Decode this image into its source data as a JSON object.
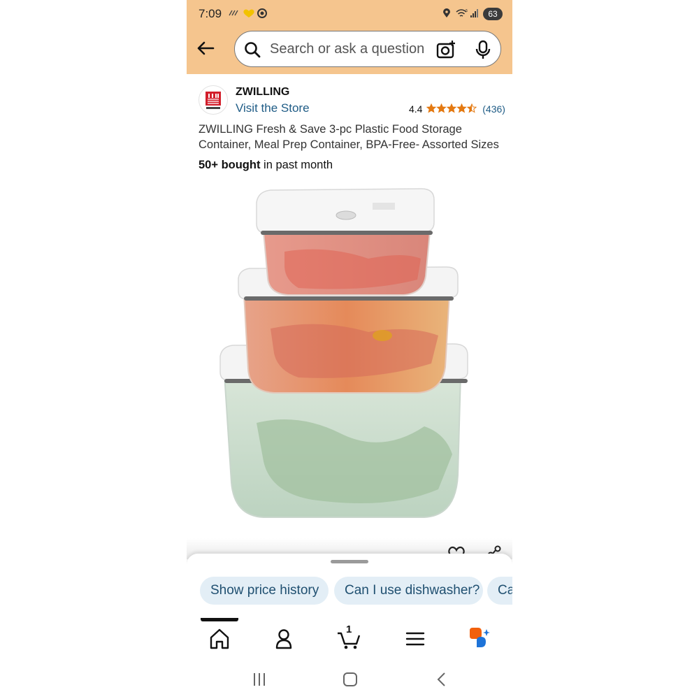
{
  "status_bar": {
    "time": "7:09",
    "battery": "63",
    "icons": [
      "signal-lines-icon",
      "heart-wing-icon",
      "record-icon",
      "location-icon",
      "wifi-icon",
      "cell-signal-icon"
    ]
  },
  "header": {
    "search_placeholder": "Search or ask a question",
    "icons": [
      "back-arrow-icon",
      "search-icon",
      "camera-icon",
      "mic-icon"
    ],
    "background_color": "#F5C58E"
  },
  "product": {
    "brand": "ZWILLING",
    "visit_store": "Visit the Store",
    "rating": "4.4",
    "rating_stars": 4.4,
    "review_count": "(436)",
    "title": "ZWILLING Fresh & Save 3-pc Plastic Food Storage Container, Meal Prep Container, BPA-Free- Assorted Sizes",
    "bought_count": "50+ bought",
    "bought_suffix": " in past month",
    "star_color": "#E47911",
    "link_color": "#1F5C86"
  },
  "suggestions": [
    {
      "label": "Show price history"
    },
    {
      "label": "Can I use dishwasher?"
    },
    {
      "label": "Ca"
    }
  ],
  "bottom_nav": {
    "items": [
      "home-icon",
      "account-icon",
      "cart-icon",
      "menu-icon",
      "rufus-icon"
    ],
    "cart_count": "1",
    "active": "home"
  },
  "system_nav": [
    "recents-icon",
    "home-icon",
    "back-icon"
  ]
}
